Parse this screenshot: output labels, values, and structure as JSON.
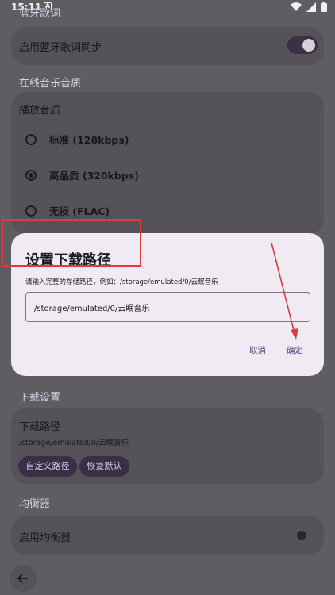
{
  "status": {
    "time": "15:11"
  },
  "sections": {
    "bt_lyrics": "蓝牙歌词",
    "online_quality": "在线音乐音质",
    "download_settings": "下载设置",
    "equalizer": "均衡器"
  },
  "bt_card": {
    "label": "启用蓝牙歌词同步",
    "toggle_on": true
  },
  "quality_card": {
    "label": "播放音质",
    "options": [
      {
        "label": "标准 (128kbps)",
        "checked": false
      },
      {
        "label": "高品质 (320kbps)",
        "checked": true
      },
      {
        "label": "无损 (FLAC)",
        "checked": false
      }
    ]
  },
  "download_card": {
    "label": "下载路径",
    "path": "/storage/emulated/0/云眠音乐",
    "custom_button": "自定义路径",
    "reset_button": "恢复默认"
  },
  "eq_card": {
    "label": "启用均衡器",
    "toggle_on": false
  },
  "dialog": {
    "title": "设置下载路径",
    "hint": "请输入完整的存储路径，例如：/storage/emulated/0/云眠音乐",
    "input_value": "/storage/emulated/0/云眠音乐",
    "cancel": "取消",
    "confirm": "确定"
  },
  "colors": {
    "accent": "#5a4a7a",
    "annotation": "#e0393e",
    "scrim_bg": "#5f5c62",
    "dialog_bg": "#f0eaf3"
  }
}
